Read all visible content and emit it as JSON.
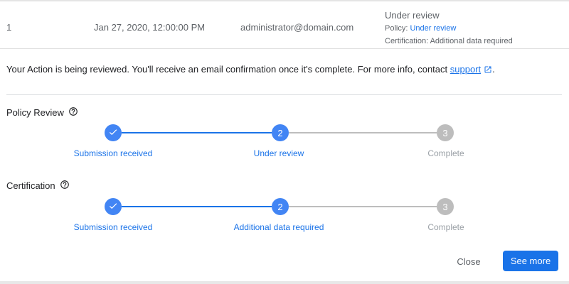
{
  "row": {
    "number": "1",
    "date": "Jan 27, 2020, 12:00:00 PM",
    "email": "administrator@domain.com",
    "status_title": "Under review",
    "policy_prefix": "Policy: ",
    "policy_value": "Under review",
    "certification_text": "Certification: Additional data required"
  },
  "message": {
    "text": "Your Action is being reviewed. You'll receive an email confirmation once it's complete. For more info, contact ",
    "link": "support",
    "suffix": "."
  },
  "policy_review": {
    "label": "Policy Review",
    "steps": [
      {
        "number": "",
        "label": "Submission received",
        "state": "done"
      },
      {
        "number": "2",
        "label": "Under review",
        "state": "active"
      },
      {
        "number": "3",
        "label": "Complete",
        "state": "pending"
      }
    ]
  },
  "certification": {
    "label": "Certification",
    "steps": [
      {
        "number": "",
        "label": "Submission received",
        "state": "done"
      },
      {
        "number": "2",
        "label": "Additional data required",
        "state": "active"
      },
      {
        "number": "3",
        "label": "Complete",
        "state": "pending"
      }
    ]
  },
  "actions": {
    "close": "Close",
    "see_more": "See more"
  },
  "colors": {
    "accent": "#1a73e8",
    "active_step": "#4285f4",
    "pending": "#bdbdbd"
  },
  "icons": [
    "check-icon",
    "external-link-icon",
    "help-icon"
  ]
}
